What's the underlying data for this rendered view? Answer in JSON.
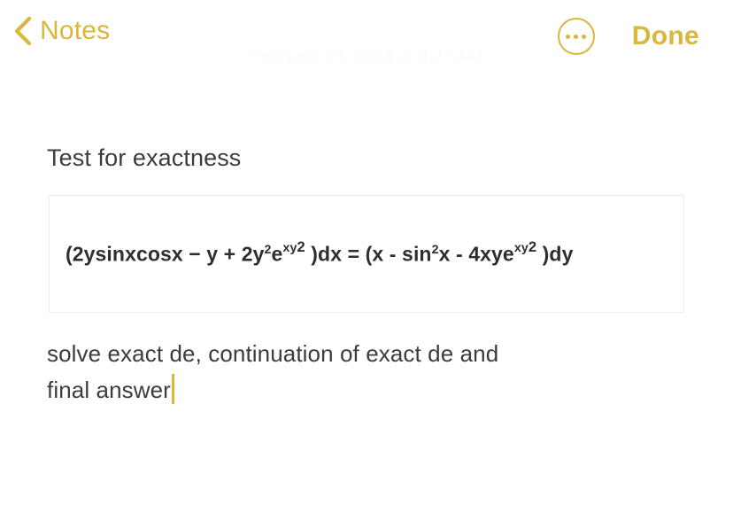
{
  "navbar": {
    "back_icon": "chevron-left-icon",
    "back_label": "Notes",
    "more_icon": "ellipsis-circle-icon",
    "done_label": "Done",
    "accent_color": "#d9b63c"
  },
  "note": {
    "date_watermark": "February 15, 2023 at 9:27 AM",
    "title": "Test for exactness",
    "formula": {
      "lhs_open": "(2ysinxcosx − y + 2y",
      "lhs_sq": "2",
      "lhs_e": "e",
      "lhs_exp_base": "xy",
      "lhs_exp_sup": "2",
      "lhs_close": " )dx",
      "equals": "=",
      "rhs_open": "(x - sin",
      "rhs_sq": "2",
      "rhs_mid": "x - 4xye",
      "rhs_exp_base": "xy",
      "rhs_exp_sup": "2",
      "rhs_close": " )dy",
      "plain_text": "(2ysinxcosx − y + 2y²e^(xy²) )dx = (x - sin²x - 4xye^(xy²) )dy"
    },
    "paragraph_line1": "solve exact de, continuation of exact de and",
    "paragraph_line2": "final answer",
    "cursor_color": "#d9b63c",
    "text_color": "#3c3c3c"
  }
}
